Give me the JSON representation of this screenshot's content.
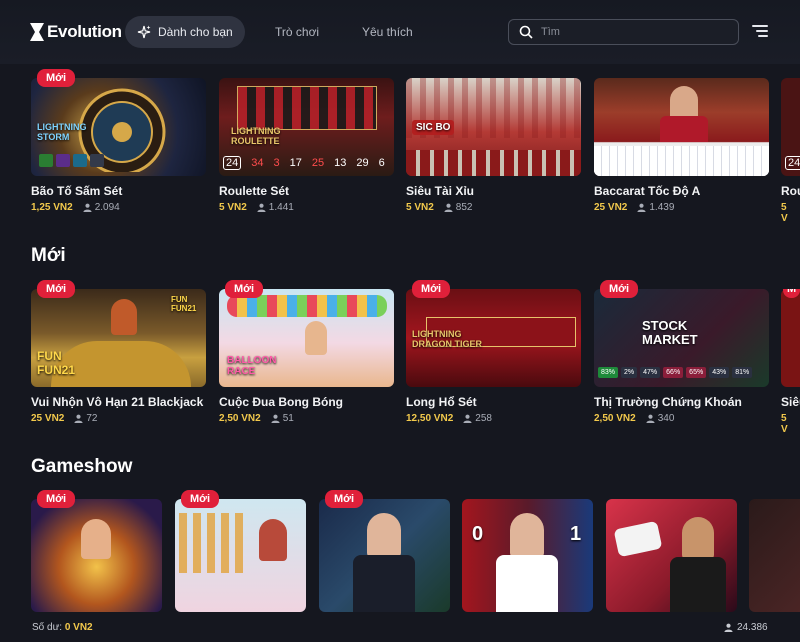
{
  "header": {
    "logo": "Evolution",
    "nav": {
      "for_you": "Dành cho bạn",
      "games": "Trò chơi",
      "favorites": "Yêu thích"
    },
    "search": {
      "placeholder": "Tìm",
      "value": ""
    }
  },
  "section_top": {
    "cards": [
      {
        "badge": "Mới",
        "name": "Bão Tố Sấm Sét",
        "price": "1,25 VN2",
        "players": "2.094"
      },
      {
        "name": "Roulette Sét",
        "price": "5 VN2",
        "players": "1.441",
        "numbers": [
          "24",
          "34",
          "3",
          "17",
          "25",
          "13",
          "29",
          "6"
        ]
      },
      {
        "name": "Siêu Tài Xỉu",
        "price": "5 VN2",
        "players": "852"
      },
      {
        "name": "Baccarat Tốc Độ A",
        "price": "25 VN2",
        "players": "1.439"
      },
      {
        "name": "Rou",
        "price": "5 V",
        "number": "24"
      }
    ]
  },
  "section_new": {
    "title": "Mới",
    "cards": [
      {
        "badge": "Mới",
        "name": "Vui Nhộn Vô Hạn 21 Blackjack",
        "price": "25 VN2",
        "players": "72"
      },
      {
        "badge": "Mới",
        "name": "Cuộc Đua Bong Bóng",
        "price": "2,50 VN2",
        "players": "51"
      },
      {
        "badge": "Mới",
        "name": "Long Hổ Sét",
        "price": "12,50 VN2",
        "players": "258"
      },
      {
        "badge": "Mới",
        "name": "Thị Trường Chứng Khoán",
        "price": "2,50 VN2",
        "players": "340",
        "stats": [
          "83%",
          "2%",
          "47%",
          "66%",
          "65%",
          "43%",
          "81%"
        ]
      },
      {
        "badge": "M",
        "name": "Siêu",
        "price": "5 V"
      }
    ]
  },
  "section_gameshow": {
    "title": "Gameshow",
    "cards": [
      {
        "badge": "Mới"
      },
      {
        "badge": "Mới"
      },
      {
        "badge": "Mới"
      },
      {},
      {},
      {}
    ]
  },
  "footer": {
    "balance_label": "Số dư:",
    "balance_value": "0 VN2",
    "online_count": "24.386"
  }
}
